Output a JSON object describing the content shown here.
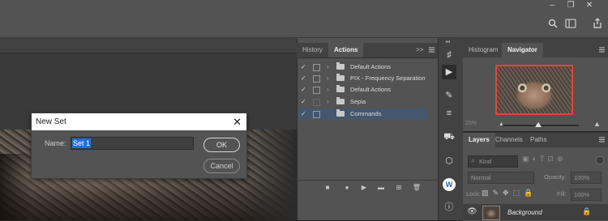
{
  "dialog": {
    "title": "New Set",
    "close_glyph": "✕",
    "name_label": "Name:",
    "name_value": "Set 1",
    "ok_label": "OK",
    "cancel_label": "Cancel"
  },
  "actions_panel": {
    "tabs": [
      {
        "label": "History",
        "active": false
      },
      {
        "label": "Actions",
        "active": true
      }
    ],
    "menu_glyphs": ">>",
    "rows": [
      {
        "label": "Default Actions",
        "checked": true,
        "selected": false
      },
      {
        "label": "PIX - Frequency Separation",
        "checked": true,
        "selected": false
      },
      {
        "label": "Default Actions",
        "checked": true,
        "selected": false
      },
      {
        "label": "Sepia",
        "checked": false,
        "selected": false
      },
      {
        "label": "Commands",
        "checked": true,
        "selected": true
      }
    ],
    "selection_color": "#44576d"
  },
  "navigator_panel": {
    "tabs": [
      {
        "label": "Histogram",
        "active": false
      },
      {
        "label": "Navigator",
        "active": true
      }
    ],
    "zoom_label": "25%",
    "viewbox_color": "#e0463a"
  },
  "layers_panel": {
    "tabs": [
      {
        "label": "Layers",
        "active": true
      },
      {
        "label": "Channels",
        "active": false
      },
      {
        "label": "Paths",
        "active": false
      }
    ],
    "kind_label": "Kind",
    "blend_mode": "Normal",
    "opacity_label": "Opacity:",
    "opacity_value": "100%",
    "lock_label": "Lock:",
    "fill_label": "Fill:",
    "fill_value": "100%",
    "layer_name": "Background"
  },
  "toolstrip": {
    "icons": [
      "brush-settings-icon",
      "play-icon",
      "brush-icon",
      "sliders-icon",
      "stamp-icon",
      "cube-icon",
      "w-icon",
      "info-icon"
    ]
  },
  "colors": {
    "dialog_accent": "#1e6fd9",
    "panel_bg": "#535353",
    "workspace_bg": "#262626"
  }
}
